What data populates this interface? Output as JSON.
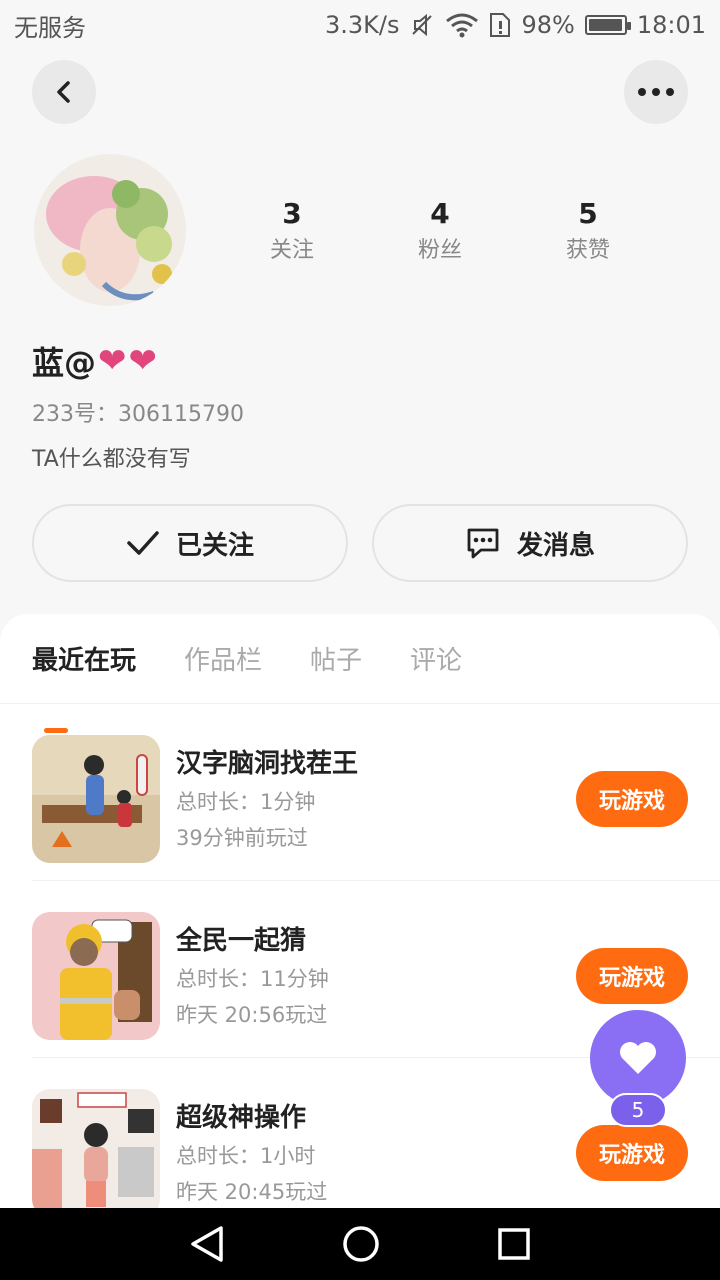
{
  "status_bar": {
    "carrier": "无服务",
    "speed": "3.3K/s",
    "battery": "98%",
    "battery_level": 0.98,
    "time": "18:01"
  },
  "header": {
    "back_icon": "chevron-left-icon",
    "more_icon": "more-dots-icon"
  },
  "profile": {
    "username": "蓝@",
    "hearts": [
      "❤",
      "❤"
    ],
    "uid": "233号：306115790",
    "bio": "TA什么都没有写",
    "stats": [
      {
        "value": "3",
        "label": "关注"
      },
      {
        "value": "4",
        "label": "粉丝"
      },
      {
        "value": "5",
        "label": "获赞"
      }
    ]
  },
  "actions": {
    "follow_label": "已关注",
    "message_label": "发消息"
  },
  "tabs": [
    {
      "label": "最近在玩",
      "active": true
    },
    {
      "label": "作品栏",
      "active": false
    },
    {
      "label": "帖子",
      "active": false
    },
    {
      "label": "评论",
      "active": false
    }
  ],
  "games": [
    {
      "title": "汉字脑洞找茬王",
      "duration": "总时长：1分钟",
      "last_played": "39分钟前玩过",
      "button": "玩游戏"
    },
    {
      "title": "全民一起猜",
      "duration": "总时长：11分钟",
      "last_played": "昨天 20:56玩过",
      "button": "玩游戏"
    },
    {
      "title": "超级神操作",
      "duration": "总时长：1小时",
      "last_played": "昨天 20:45玩过",
      "button": "玩游戏"
    }
  ],
  "floating_like": {
    "icon": "heart-icon",
    "count": "5"
  },
  "colors": {
    "accent": "#ff6b10",
    "like": "#8a6ef4",
    "heart": "#e0457b"
  }
}
